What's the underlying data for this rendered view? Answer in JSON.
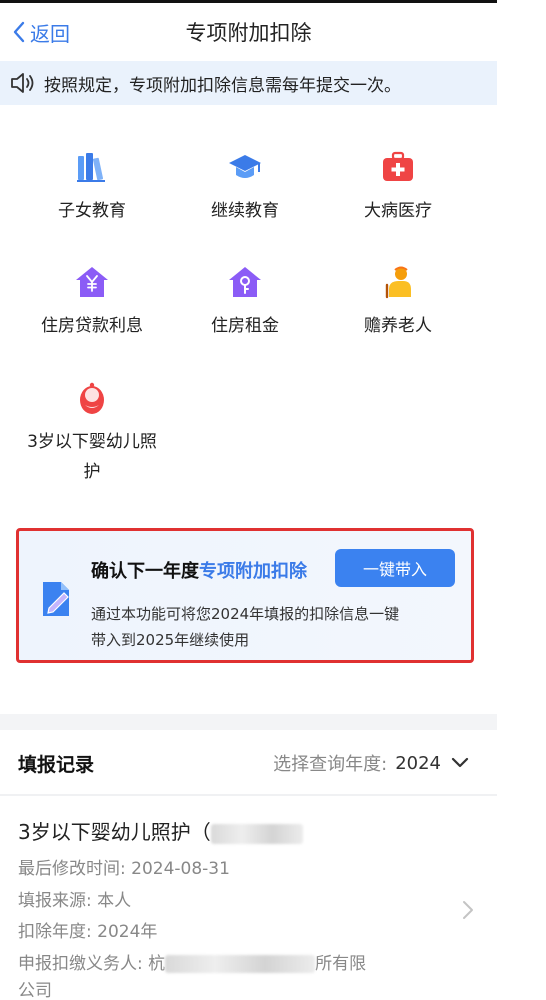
{
  "header": {
    "back_label": "返回",
    "title": "专项附加扣除"
  },
  "notice": {
    "text": "按照规定，专项附加扣除信息需每年提交一次。",
    "icon": "speaker-icon"
  },
  "categories": [
    {
      "label": "子女教育",
      "icon": "books-icon",
      "color": "#3b82f0"
    },
    {
      "label": "继续教育",
      "icon": "graduation-cap-icon",
      "color": "#3b82f0"
    },
    {
      "label": "大病医疗",
      "icon": "medical-kit-icon",
      "color": "#ef4444"
    },
    {
      "label": "住房贷款利息",
      "icon": "house-yuan-icon",
      "color": "#8b5cf6"
    },
    {
      "label": "住房租金",
      "icon": "house-key-icon",
      "color": "#8b5cf6"
    },
    {
      "label": "赡养老人",
      "icon": "elder-icon",
      "color": "#f59e0b"
    },
    {
      "label_line1": "3岁以下婴幼儿照",
      "label_line2": "护",
      "icon": "infant-icon",
      "color": "#ef4444"
    }
  ],
  "card": {
    "title_prefix": "确认下一年度",
    "title_highlight": "专项附加扣除",
    "button_label": "一键带入",
    "desc_line1": "通过本功能可将您2024年填报的扣除信息一键",
    "desc_line2": "带入到2025年继续使用",
    "icon": "document-edit-icon",
    "accent": "#3b82f0"
  },
  "records": {
    "title": "填报记录",
    "year_label": "选择查询年度:",
    "year_value": "2024",
    "item": {
      "name": "3岁以下婴幼儿照护（",
      "modified_label": "最后修改时间:",
      "modified_value": "2024-08-31",
      "source_label": "填报来源:",
      "source_value": "本人",
      "year_label": "扣除年度:",
      "year_value": "2024年",
      "agent_label": "申报扣缴义务人:",
      "agent_value_start": "杭",
      "agent_value_end": "所有限",
      "agent_value_wrap": "公司"
    }
  }
}
